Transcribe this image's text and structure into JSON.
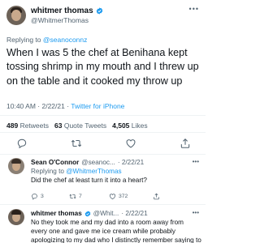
{
  "tweet": {
    "display_name": "whitmer thomas",
    "handle": "@WhitmerThomas",
    "replying_prefix": "Replying to",
    "replying_to": "@seanoconnz",
    "text": "When I was 5 the chef at Benihana kept tossing shrimp in my mouth and I threw up on the table and it cooked my throw up",
    "time": "10:40 AM",
    "date": "2/22/21",
    "source": "Twitter for iPhone",
    "retweets": "489",
    "retweets_label": "Retweets",
    "quotes": "63",
    "quotes_label": "Quote Tweets",
    "likes": "4,505",
    "likes_label": "Likes"
  },
  "replies": [
    {
      "display_name": "Sean O'Connor",
      "handle": "@seanoc...",
      "date": "· 2/22/21",
      "replying_prefix": "Replying to",
      "replying_to": "@WhitmerThomas",
      "text": "Did the chef at least turn it into a heart?",
      "reply_count": "3",
      "retweet_count": "7",
      "like_count": "372"
    },
    {
      "display_name": "whitmer thomas",
      "handle": "@Whit...",
      "date": "· 2/22/21",
      "text": "No they took me and my dad into a room away from every one and gave me ice cream while probably apologizing to my dad who I distinctly remember saying to the chef \"cool it with the shrimp pal\"",
      "reply_count": "12",
      "retweet_count": "20",
      "like_count": "1,271"
    }
  ],
  "colors": {
    "accent": "#1d9bf0",
    "text": "#0f1419",
    "secondary": "#536471",
    "divider": "#eff3f4"
  },
  "icons": [
    "verified-badge-icon",
    "more-icon",
    "reply-icon",
    "retweet-icon",
    "like-icon",
    "share-icon"
  ]
}
